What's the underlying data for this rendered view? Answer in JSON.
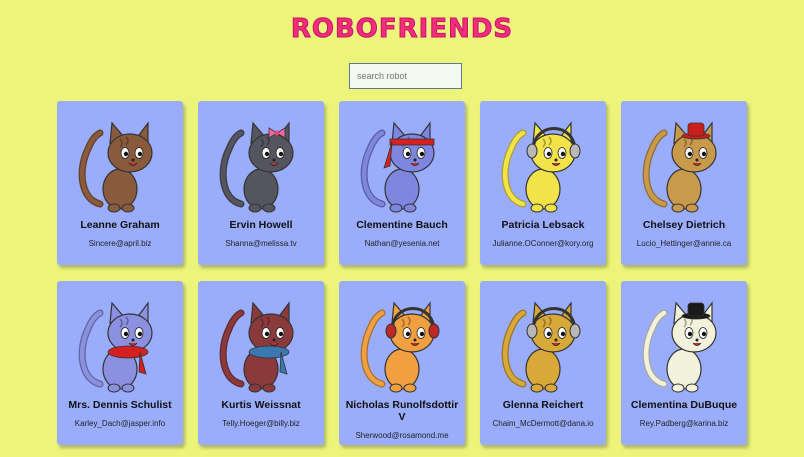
{
  "app": {
    "title": "ROBOFRIENDS"
  },
  "search": {
    "placeholder": "search robot"
  },
  "colors": {
    "background": "#ecf57a",
    "card": "#9aadfc",
    "title": "#f02e7a"
  },
  "robots": [
    {
      "name": "Leanne Graham",
      "email": "Sincere@april.biz",
      "fur": "#8a5a3c",
      "accessory": "none"
    },
    {
      "name": "Ervin Howell",
      "email": "Shanna@melissa.tv",
      "fur": "#555560",
      "accessory": "pink-bow"
    },
    {
      "name": "Clementine Bauch",
      "email": "Nathan@yesenia.net",
      "fur": "#7f86e0",
      "accessory": "red-headband"
    },
    {
      "name": "Patricia Lebsack",
      "email": "Julianne.OConner@kory.org",
      "fur": "#f2e34a",
      "accessory": "headphones-gray"
    },
    {
      "name": "Chelsey Dietrich",
      "email": "Lucio_Hettinger@annie.ca",
      "fur": "#c99a4c",
      "accessory": "red-hat"
    },
    {
      "name": "Mrs. Dennis Schulist",
      "email": "Karley_Dach@jasper.info",
      "fur": "#8c90e0",
      "accessory": "red-scarf"
    },
    {
      "name": "Kurtis Weissnat",
      "email": "Telly.Hoeger@billy.biz",
      "fur": "#8b3a3c",
      "accessory": "blue-scarf"
    },
    {
      "name": "Nicholas Runolfsdottir V",
      "email": "Sherwood@rosamond.me",
      "fur": "#f0a040",
      "accessory": "headphones-red"
    },
    {
      "name": "Glenna Reichert",
      "email": "Chaim_McDermott@dana.io",
      "fur": "#d8a838",
      "accessory": "headphones-gray"
    },
    {
      "name": "Clementina DuBuque",
      "email": "Rey.Padberg@karina.biz",
      "fur": "#f2f2dc",
      "accessory": "black-hat"
    }
  ]
}
